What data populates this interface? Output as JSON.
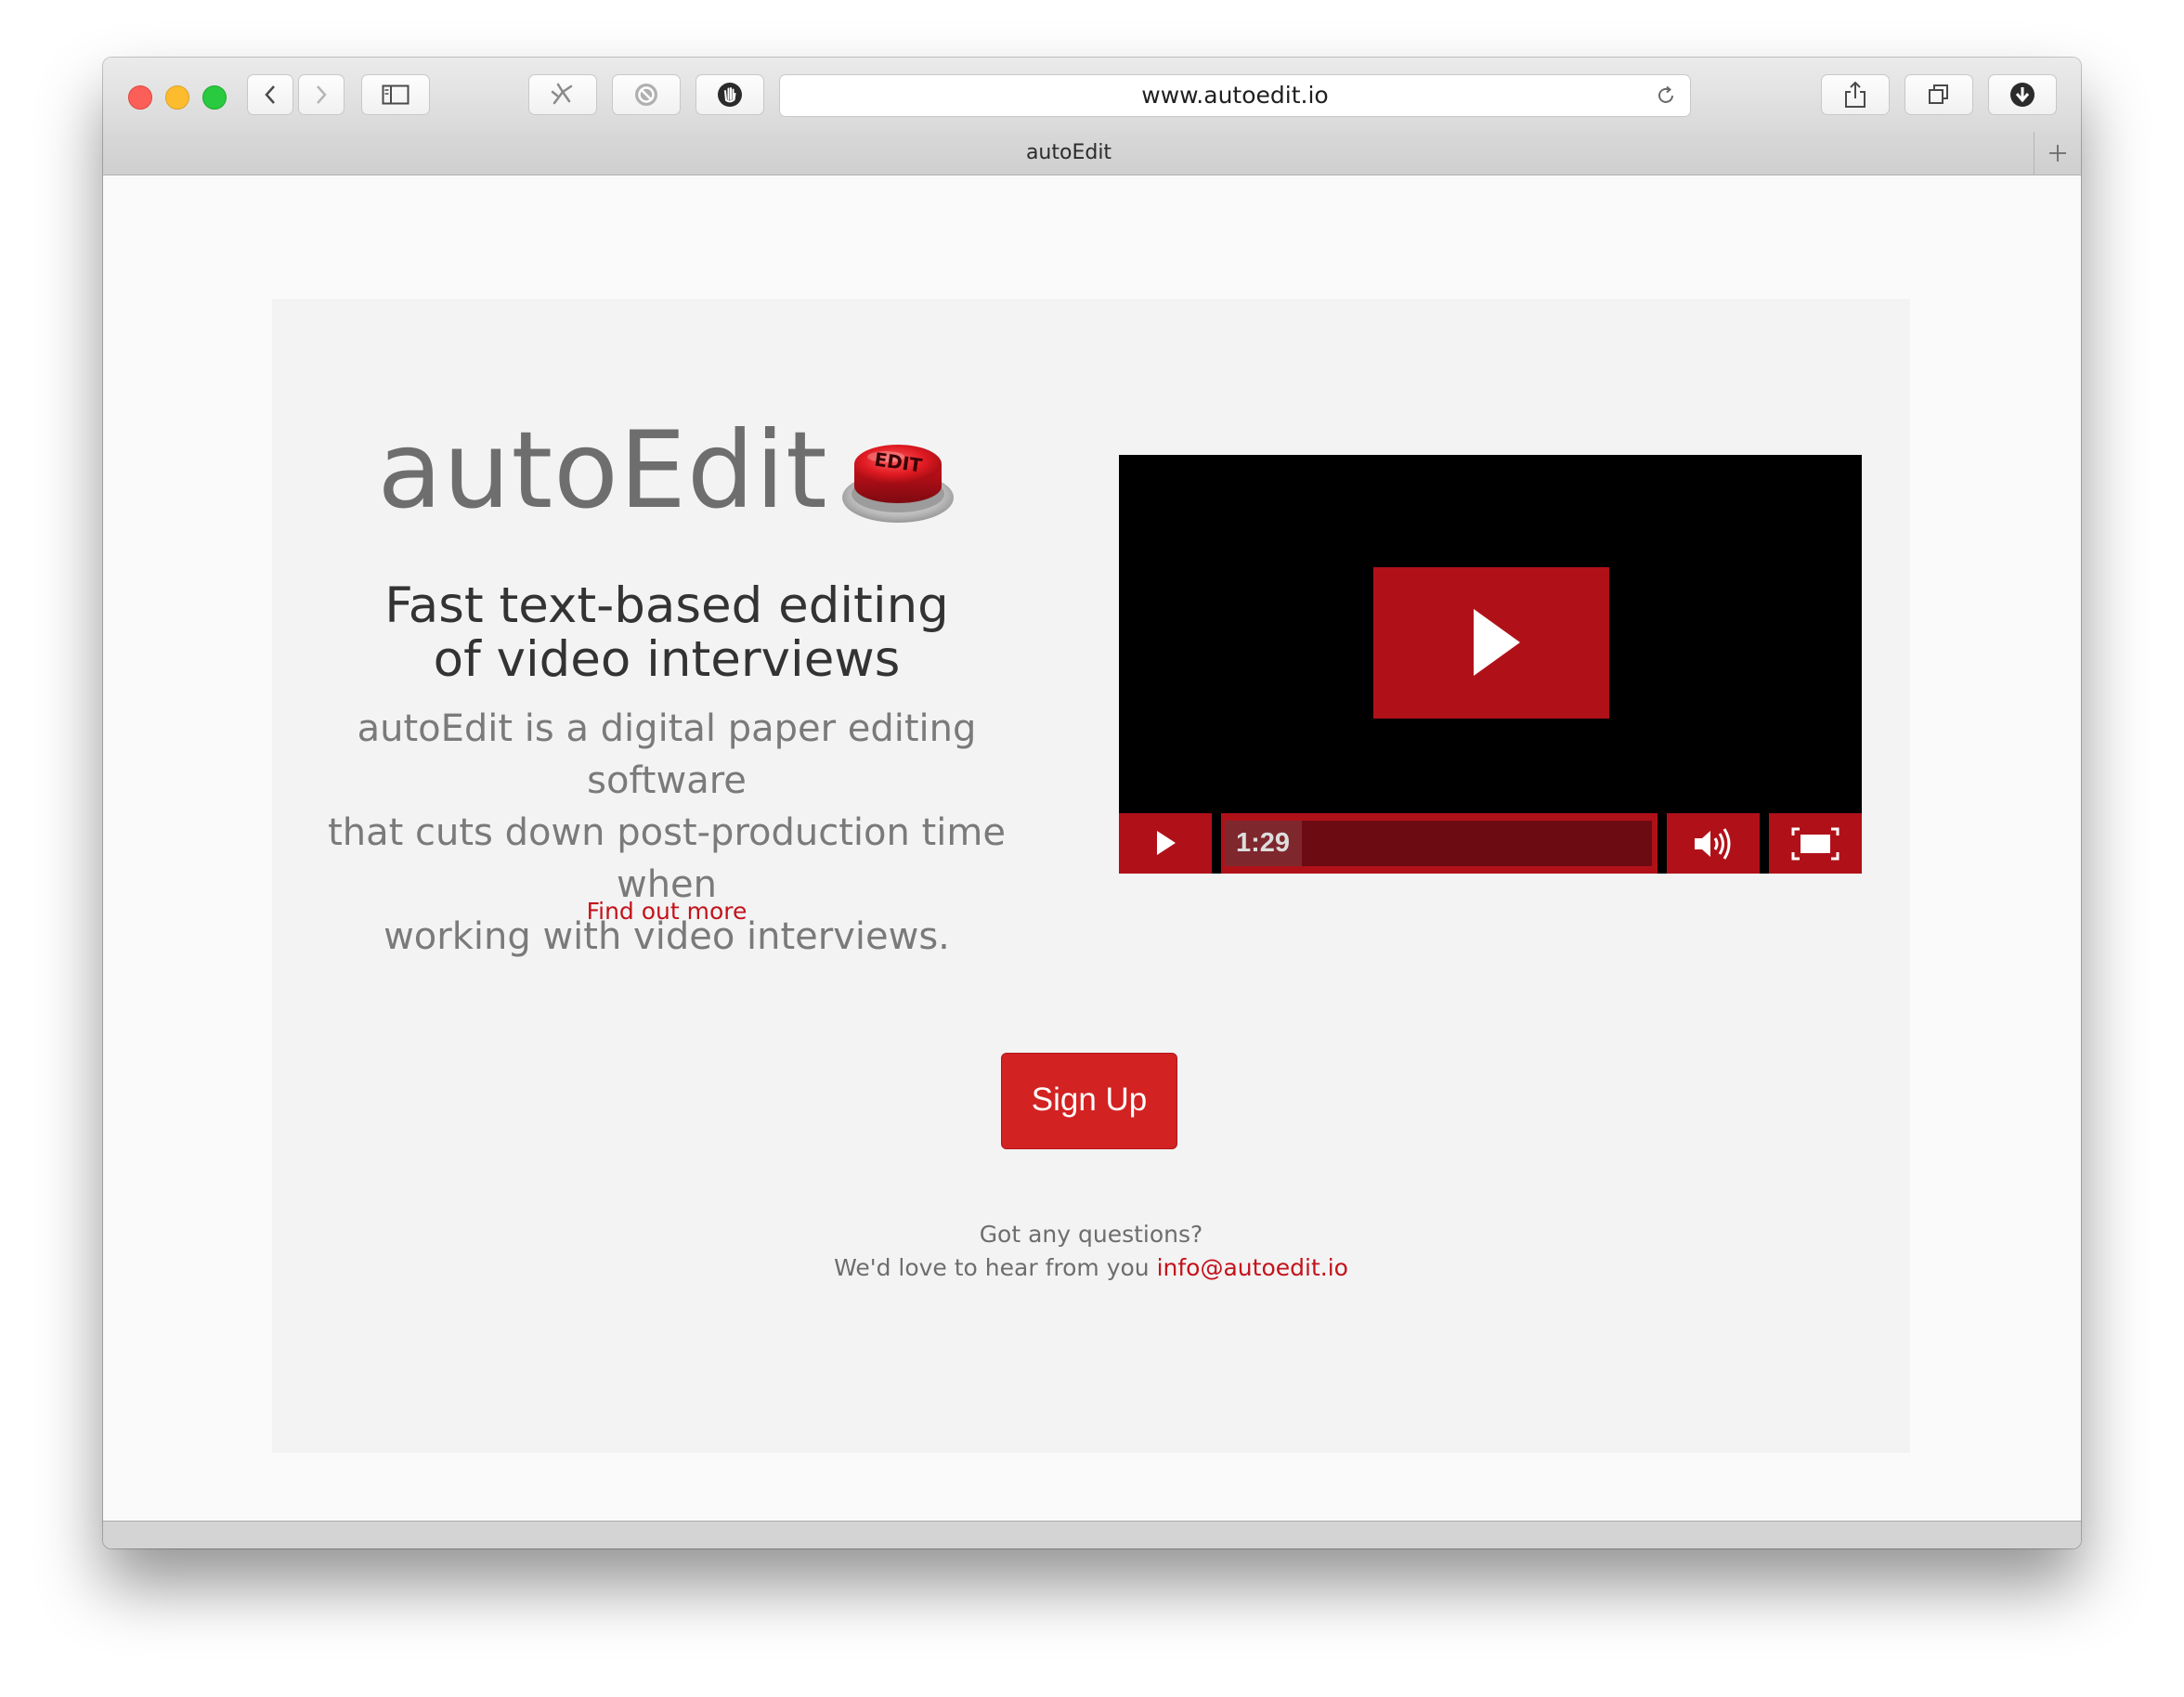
{
  "browser": {
    "url": "www.autoedit.io",
    "tab_title": "autoEdit",
    "toolbar_icons": [
      "back-icon",
      "forward-icon",
      "sidebar-icon",
      "extension-icon",
      "block-icon",
      "hand-icon",
      "reload-icon",
      "share-icon",
      "tabs-icon",
      "download-icon",
      "new-tab-icon"
    ]
  },
  "hero": {
    "logo_text": "autoEdit",
    "logo_button_label": "EDIT",
    "headline_line1": "Fast text-based editing",
    "headline_line2": "of video interviews",
    "description_line1": "autoEdit is a digital paper editing software",
    "description_line2": "that cuts down post-production time when",
    "description_line3": "working with video interviews.",
    "find_more_label": "Find out more"
  },
  "video": {
    "duration": "1:29",
    "progress_fraction": 0.18
  },
  "signup_label": "Sign Up",
  "contact": {
    "question": "Got any questions?",
    "prompt": "We'd love to hear from you",
    "email": "info@autoedit.io"
  },
  "colors": {
    "accent": "#c4121b",
    "video_controls": "#b01119",
    "signup": "#d32222",
    "hero_bg": "#f3f3f3"
  }
}
